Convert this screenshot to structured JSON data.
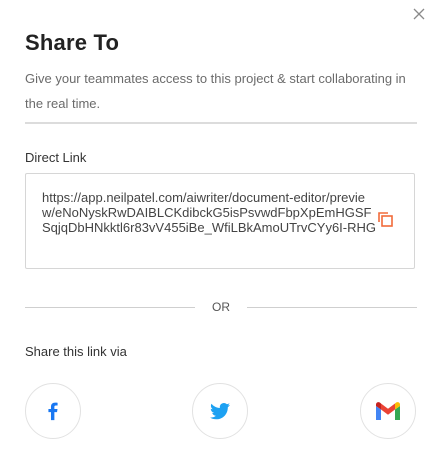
{
  "dialog": {
    "title": "Share To",
    "subtitle": "Give your teammates access to this project & start collaborating in the real time.",
    "close_icon": "close-icon"
  },
  "direct_link": {
    "label": "Direct Link",
    "url": "https://app.neilpatel.com/aiwriter/document-editor/preview/eNoNyskRwDAIBLCKdibckG5isPsvwdFbpXpEmHGSFSqjqDbHNkktl6r83vV455iBe_WfiLBkAmoUTrvCYy6I-RHG",
    "copy_icon": "copy-icon"
  },
  "separator": {
    "text": "OR"
  },
  "share_via": {
    "label": "Share this link via",
    "options": [
      {
        "name": "facebook",
        "icon": "facebook-icon",
        "color": "#1877f2"
      },
      {
        "name": "twitter",
        "icon": "twitter-icon",
        "color": "#1da1f2"
      },
      {
        "name": "gmail",
        "icon": "gmail-icon",
        "color": "#ea4335"
      }
    ]
  },
  "colors": {
    "accent": "#f26b3a",
    "divider": "#dcdcdc"
  }
}
